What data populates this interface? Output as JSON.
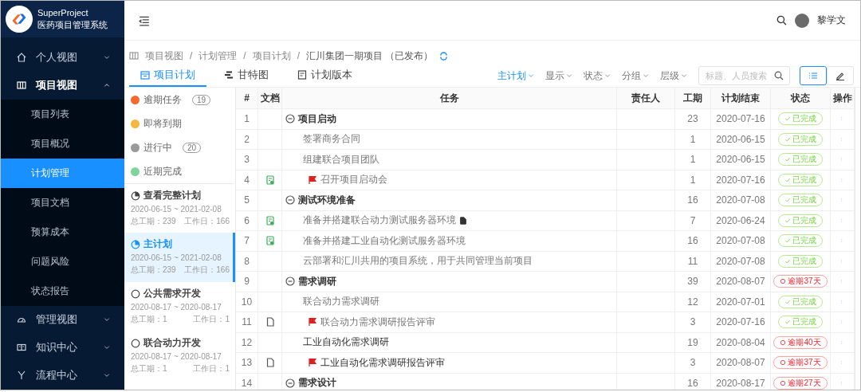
{
  "brand": {
    "name": "SuperProject",
    "subtitle": "医药项目管理系统"
  },
  "sidebar": {
    "items": [
      {
        "label": "个人视图",
        "expanded": false
      },
      {
        "label": "项目视图",
        "expanded": true,
        "children": [
          {
            "label": "项目列表",
            "selected": false
          },
          {
            "label": "项目概况",
            "selected": false
          },
          {
            "label": "计划管理",
            "selected": true
          },
          {
            "label": "项目文档",
            "selected": false
          },
          {
            "label": "预算成本",
            "selected": false
          },
          {
            "label": "问题风险",
            "selected": false
          },
          {
            "label": "状态报告",
            "selected": false
          }
        ]
      },
      {
        "label": "管理视图",
        "expanded": false
      },
      {
        "label": "知识中心",
        "expanded": false
      },
      {
        "label": "流程中心",
        "expanded": false
      }
    ]
  },
  "user": {
    "name": "黎学文"
  },
  "breadcrumb": [
    {
      "kind": "link",
      "text": "项目视图"
    },
    {
      "kind": "separator",
      "text": "/"
    },
    {
      "kind": "link",
      "text": "计划管理"
    },
    {
      "kind": "separator",
      "text": "/"
    },
    {
      "kind": "link",
      "text": "项目计划"
    },
    {
      "kind": "separator",
      "text": "/"
    },
    {
      "kind": "current",
      "text": "汇川集团一期项目 （已发布）"
    }
  ],
  "tabs": [
    {
      "label": "项目计划",
      "selected": true
    },
    {
      "label": "甘特图",
      "selected": false
    },
    {
      "label": "计划版本",
      "selected": false
    }
  ],
  "toolbar": {
    "dropdowns": [
      {
        "label": "主计划",
        "selected": true
      },
      {
        "label": "显示",
        "selected": false
      },
      {
        "label": "状态",
        "selected": false
      },
      {
        "label": "分组",
        "selected": false
      },
      {
        "label": "层级",
        "selected": false
      }
    ],
    "search": {
      "placeholder": "标题、人员搜索"
    },
    "views": [
      {
        "kind": "list",
        "selected": true
      },
      {
        "kind": "edit",
        "selected": false
      }
    ]
  },
  "filters": [
    {
      "label": "逾期任务",
      "color": "#f56a2c",
      "count": "19"
    },
    {
      "label": "即将到期",
      "color": "#f5b642"
    },
    {
      "label": "进行中",
      "color": "#9a9a9a",
      "count": "20"
    },
    {
      "label": "近期完成",
      "color": "#7fd49c"
    }
  ],
  "plans": [
    {
      "kind": "progress",
      "title": "查看完整计划",
      "dates": "2020-06-15 ~ 2021-02-08",
      "total": "总工期：239",
      "workdays": "工作日：166",
      "selected": false
    },
    {
      "kind": "progress",
      "title": "主计划",
      "dates": "2020-06-15 ~ 2021-02-08",
      "total": "总工期：239",
      "workdays": "工作日：166",
      "selected": true
    },
    {
      "kind": "circle",
      "title": "公共需求开发",
      "dates": "2020-08-17 ~ 2020-08-17",
      "total": "总工期：1",
      "workdays": "工作日：1",
      "selected": false
    },
    {
      "kind": "circle",
      "title": "联合动力开发",
      "dates": "2020-08-17 ~ 2020-08-17",
      "total": "总工期：1",
      "workdays": "工作日：1",
      "selected": false
    }
  ],
  "table": {
    "columns": [
      "#",
      "文档",
      "任务",
      "责任人",
      "工期",
      "计划结束",
      "状态",
      "操作"
    ],
    "tasks": [
      {
        "num": "1",
        "title": "项目启动",
        "duration": "23",
        "end": "2020-07-16",
        "status": {
          "kind": "done",
          "label": "已完成"
        },
        "expanded": true,
        "children": [
          {
            "num": "2",
            "title": "签署商务合同",
            "duration": "1",
            "end": "2020-06-15",
            "status": {
              "kind": "done",
              "label": "已完成"
            }
          },
          {
            "num": "3",
            "title": "组建联合项目团队",
            "duration": "1",
            "end": "2020-06-15",
            "status": {
              "kind": "done",
              "label": "已完成"
            }
          },
          {
            "num": "4",
            "doc": {
              "kind": "form"
            },
            "milestone": true,
            "title": "召开项目启动会",
            "duration": "1",
            "end": "2020-07-16",
            "status": {
              "kind": "done",
              "label": "已完成"
            }
          }
        ]
      },
      {
        "num": "5",
        "title": "测试环境准备",
        "duration": "16",
        "end": "2020-07-08",
        "status": {
          "kind": "done",
          "label": "已完成"
        },
        "expanded": true,
        "children": [
          {
            "num": "6",
            "doc": {
              "kind": "form"
            },
            "title": "准备并搭建联合动力测试服务器环境",
            "attachment": true,
            "duration": "7",
            "end": "2020-06-24",
            "status": {
              "kind": "done",
              "label": "已完成"
            }
          },
          {
            "num": "7",
            "doc": {
              "kind": "form"
            },
            "title": "准备并搭建工业自动化测试服务器环境",
            "duration": "16",
            "end": "2020-07-08",
            "status": {
              "kind": "done",
              "label": "已完成"
            }
          },
          {
            "num": "8",
            "title": "云部署和汇川共用的项目系统，用于共同管理当前项目",
            "duration": "11",
            "end": "2020-07-08",
            "status": {
              "kind": "done",
              "label": "已完成"
            }
          }
        ]
      },
      {
        "num": "9",
        "title": "需求调研",
        "duration": "39",
        "end": "2020-08-07",
        "status": {
          "kind": "overdue",
          "label": "逾期37天"
        },
        "expanded": true,
        "children": [
          {
            "num": "10",
            "title": "联合动力需求调研",
            "duration": "12",
            "end": "2020-07-01",
            "status": {
              "kind": "done",
              "label": "已完成"
            }
          },
          {
            "num": "11",
            "doc": {
              "kind": "file"
            },
            "milestone": true,
            "title": "联合动力需求调研报告评审",
            "duration": "3",
            "end": "2020-07-16",
            "status": {
              "kind": "done",
              "label": "已完成"
            }
          },
          {
            "num": "12",
            "title": "工业自动化需求调研",
            "duration": "19",
            "end": "2020-08-04",
            "status": {
              "kind": "overdue",
              "label": "逾期40天"
            }
          },
          {
            "num": "13",
            "doc": {
              "kind": "file"
            },
            "milestone": true,
            "title": "工业自动化需求调研报告评审",
            "duration": "3",
            "end": "2020-08-07",
            "status": {
              "kind": "overdue",
              "label": "逾期37天"
            }
          }
        ]
      },
      {
        "num": "14",
        "title": "需求设计",
        "duration": "16",
        "end": "2020-08-17",
        "status": {
          "kind": "overdue",
          "label": "逾期27天"
        },
        "expanded": true
      }
    ]
  }
}
